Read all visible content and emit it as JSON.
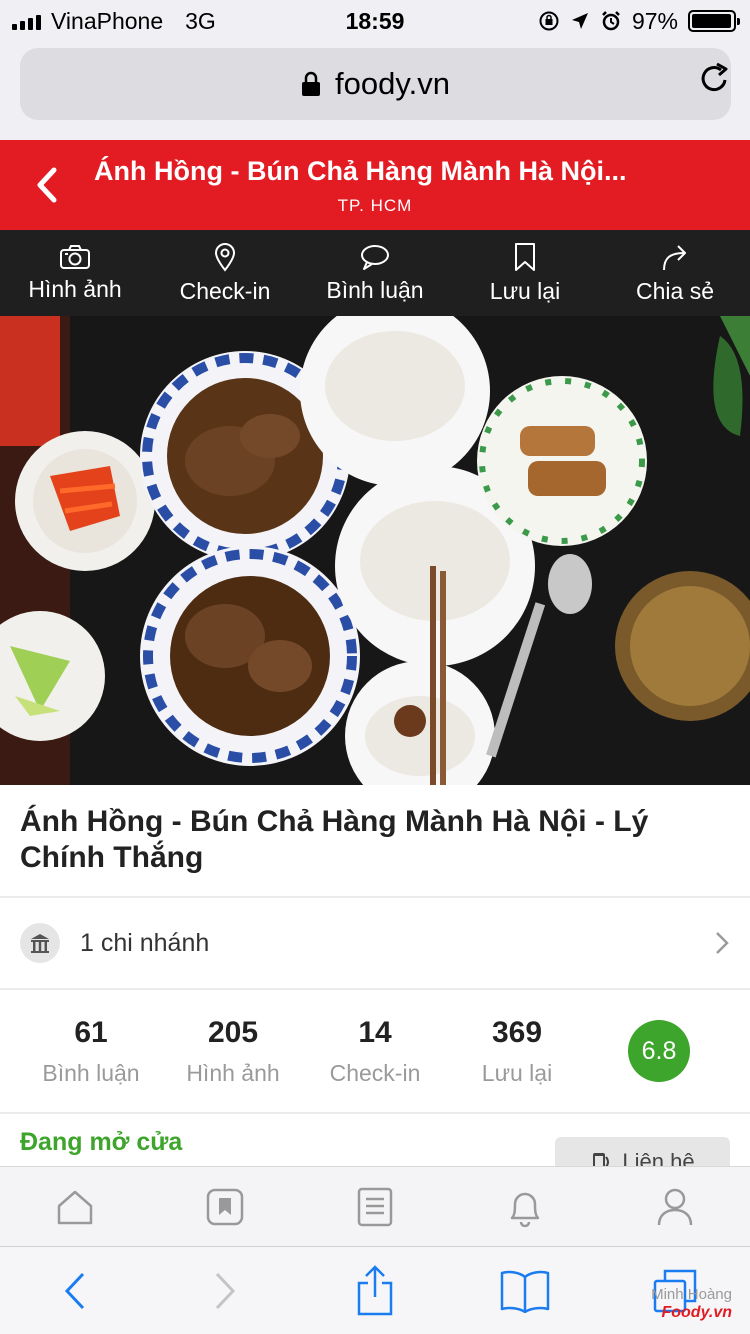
{
  "status_bar": {
    "carrier": "VinaPhone",
    "network": "3G",
    "time": "18:59",
    "battery": "97%",
    "battery_level": 0.97
  },
  "browser": {
    "url": "foody.vn"
  },
  "header": {
    "title": "Ánh Hồng - Bún Chả Hàng Mành Hà Nội...",
    "subtitle": "TP. HCM"
  },
  "actions": [
    {
      "label": "Hình ảnh",
      "icon": "camera-icon"
    },
    {
      "label": "Check-in",
      "icon": "location-pin-icon"
    },
    {
      "label": "Bình luận",
      "icon": "comment-icon"
    },
    {
      "label": "Lưu lại",
      "icon": "bookmark-icon"
    },
    {
      "label": "Chia sẻ",
      "icon": "share-icon"
    }
  ],
  "restaurant": {
    "name": "Ánh Hồng - Bún Chả Hàng Mành Hà Nội - Lý Chính Thắng",
    "branches": "1 chi nhánh",
    "open_status": "Đang mở cửa",
    "contact_label": "Liên hệ",
    "score": "6.8"
  },
  "stats": [
    {
      "value": "61",
      "label": "Bình luận"
    },
    {
      "value": "205",
      "label": "Hình ảnh"
    },
    {
      "value": "14",
      "label": "Check-in"
    },
    {
      "value": "369",
      "label": "Lưu lại"
    }
  ],
  "watermark": {
    "author": "Minh Hoàng",
    "brand": "Foody.vn"
  },
  "colors": {
    "brand_red": "#e31b23",
    "open_green": "#3da52b",
    "ios_blue": "#1a7cf0"
  }
}
